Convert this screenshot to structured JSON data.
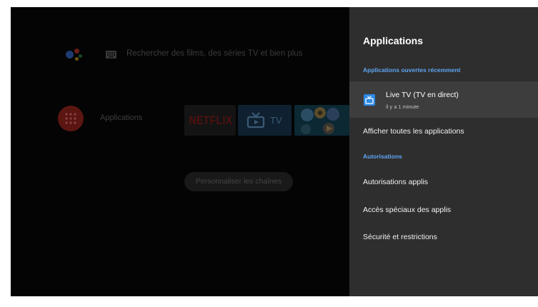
{
  "home": {
    "search": {
      "placeholder": "Rechercher des films, des séries TV et bien plus",
      "assistant_icon": "google-assistant-icon",
      "keyboard_icon": "keyboard-icon"
    },
    "apps_row": {
      "label": "Applications",
      "icon": "apps-grid-icon",
      "tiles": [
        {
          "text": "NETFLIX"
        },
        {
          "text": "TV",
          "icon": "tv-icon"
        },
        {
          "icon": "kids-app-icon"
        }
      ]
    },
    "customize_button": "Personnaliser les chaînes"
  },
  "panel": {
    "title": "Applications",
    "sections": [
      {
        "header": "Applications ouvertes récemment",
        "items": [
          {
            "label": "Live TV (TV en direct)",
            "sublabel": "il y a 1 minute",
            "icon": "tv-icon",
            "selected": true
          },
          {
            "label": "Afficher toutes les applications"
          }
        ]
      },
      {
        "header": "Autorisations",
        "items": [
          {
            "label": "Autorisations applis"
          },
          {
            "label": "Accès spéciaux des applis"
          },
          {
            "label": "Sécurité et restrictions"
          }
        ]
      }
    ]
  },
  "colors": {
    "accent": "#5ea5f2",
    "panel_bg": "#2e2e2e",
    "selected_bg": "#3d3d3d",
    "app_icon_blue": "#2b8ae6"
  }
}
